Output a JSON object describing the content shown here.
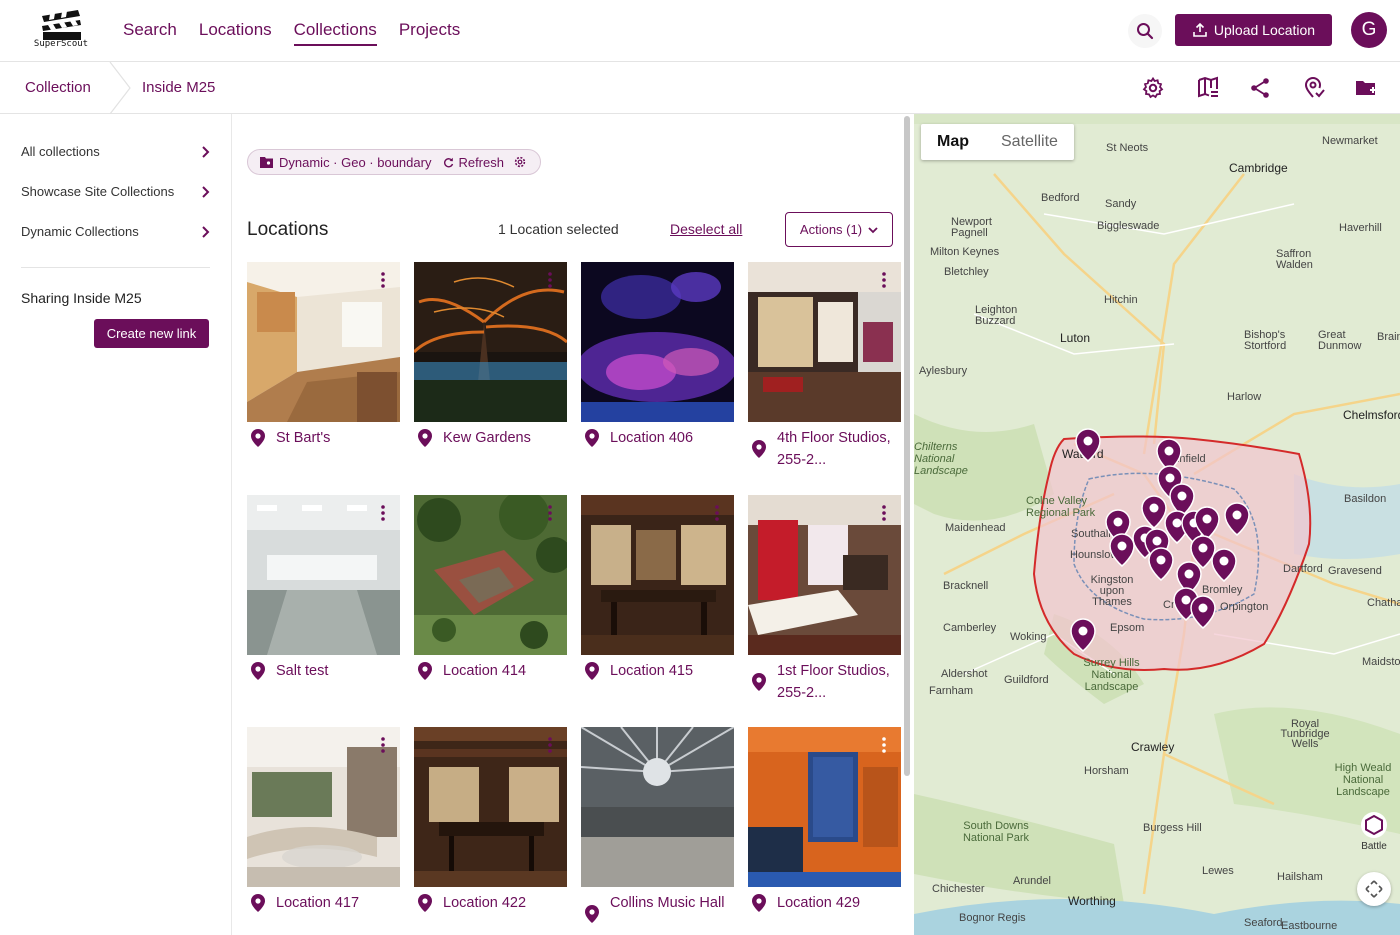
{
  "header": {
    "logo_text": "SuperScout",
    "nav": [
      "Search",
      "Locations",
      "Collections",
      "Projects"
    ],
    "active_nav": "Collections",
    "upload_label": "Upload Location",
    "avatar_letter": "G"
  },
  "breadcrumb": {
    "root": "Collection",
    "current": "Inside M25"
  },
  "toolbar_icons": [
    "settings-icon",
    "map-book-icon",
    "share-icon",
    "geo-pin-icon",
    "add-folder-icon"
  ],
  "sidebar": {
    "items": [
      {
        "label": "All collections"
      },
      {
        "label": "Showcase Site Collections"
      },
      {
        "label": "Dynamic Collections"
      }
    ],
    "sharing_title": "Sharing Inside M25",
    "create_link_label": "Create new link"
  },
  "main": {
    "chip": {
      "type_label": "Dynamic · Geo · boundary",
      "refresh_label": "Refresh"
    },
    "locations_title": "Locations",
    "selected_text": "1 Location selected",
    "deselect_label": "Deselect all",
    "actions_label": "Actions (1)",
    "cards": [
      {
        "name": "St Bart's"
      },
      {
        "name": "Kew Gardens"
      },
      {
        "name": "Location 406"
      },
      {
        "name": "4th Floor Studios, 255-2..."
      },
      {
        "name": "Salt test"
      },
      {
        "name": "Location 414"
      },
      {
        "name": "Location 415"
      },
      {
        "name": "1st Floor Studios, 255-2..."
      },
      {
        "name": "Location 417"
      },
      {
        "name": "Location 422"
      },
      {
        "name": "Collins Music Hall"
      },
      {
        "name": "Location 429"
      }
    ]
  },
  "map": {
    "toggle": {
      "map": "Map",
      "satellite": "Satellite"
    },
    "places": [
      "St Neots",
      "Newmarket",
      "Cambridge",
      "Bedford",
      "Sandy",
      "Newport Pagnell",
      "Biggleswade",
      "Haverhill",
      "Milton Keynes",
      "Bletchley",
      "Saffron Walden",
      "Hitchin",
      "Leighton Buzzard",
      "Luton",
      "Bishop's Stortford",
      "Great Dunmow",
      "Aylesbury",
      "Harlow",
      "Chelmsford",
      "Chilterns National Landscape",
      "Watford",
      "Enfield",
      "Colne Valley Regional Park",
      "Basildon",
      "Maidenhead",
      "Southall",
      "Hounslow",
      "Bracknell",
      "Kingston upon Thames",
      "Dartford",
      "Gravesend",
      "Bromley",
      "Orpington",
      "Camberley",
      "Woking",
      "Epsom",
      "Croydon",
      "Chatham",
      "Aldershot",
      "Guildford",
      "Surrey Hills National Landscape",
      "Farnham",
      "Maidstone",
      "Crawley",
      "Royal Tunbridge Wells",
      "Horsham",
      "High Weald National Landscape",
      "South Downs National Park",
      "Burgess Hill",
      "Lewes",
      "Hailsham",
      "Chichester",
      "Arundel",
      "Worthing",
      "Bognor Regis",
      "Seaford",
      "Eastbourne",
      "Brain"
    ],
    "battle_label": "Battle"
  }
}
